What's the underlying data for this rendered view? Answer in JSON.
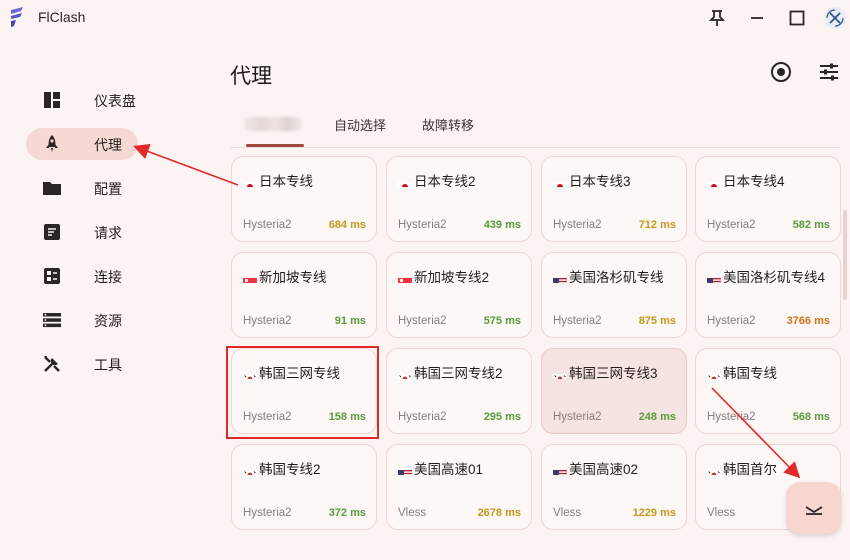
{
  "app": {
    "title": "FlClash"
  },
  "sidebar": {
    "items": [
      {
        "label": "仪表盘",
        "icon": "dashboard-icon",
        "active": false
      },
      {
        "label": "代理",
        "icon": "rocket-icon",
        "active": true
      },
      {
        "label": "配置",
        "icon": "folder-icon",
        "active": false
      },
      {
        "label": "请求",
        "icon": "request-icon",
        "active": false
      },
      {
        "label": "连接",
        "icon": "connection-icon",
        "active": false
      },
      {
        "label": "资源",
        "icon": "resources-icon",
        "active": false
      },
      {
        "label": "工具",
        "icon": "tools-icon",
        "active": false
      }
    ]
  },
  "header": {
    "title": "代理"
  },
  "tabs": [
    {
      "label": "",
      "redacted": true,
      "active": true
    },
    {
      "label": "自动选择",
      "active": false
    },
    {
      "label": "故障转移",
      "active": false
    }
  ],
  "proxies": [
    {
      "name": "日本专线",
      "flag": "jp",
      "type": "Hysteria2",
      "delay": "684 ms",
      "level": "mid"
    },
    {
      "name": "日本专线2",
      "flag": "jp",
      "type": "Hysteria2",
      "delay": "439 ms",
      "level": "good"
    },
    {
      "name": "日本专线3",
      "flag": "jp",
      "type": "Hysteria2",
      "delay": "712 ms",
      "level": "mid"
    },
    {
      "name": "日本专线4",
      "flag": "jp",
      "type": "Hysteria2",
      "delay": "582 ms",
      "level": "good"
    },
    {
      "name": "新加坡专线",
      "flag": "sg",
      "type": "Hysteria2",
      "delay": "91 ms",
      "level": "good"
    },
    {
      "name": "新加坡专线2",
      "flag": "sg",
      "type": "Hysteria2",
      "delay": "575 ms",
      "level": "good"
    },
    {
      "name": "美国洛杉矶专线",
      "flag": "us",
      "type": "Hysteria2",
      "delay": "875 ms",
      "level": "mid"
    },
    {
      "name": "美国洛杉矶专线4",
      "flag": "us",
      "type": "Hysteria2",
      "delay": "3766 ms",
      "level": "bad"
    },
    {
      "name": "韩国三网专线",
      "flag": "kr",
      "type": "Hysteria2",
      "delay": "158 ms",
      "level": "good"
    },
    {
      "name": "韩国三网专线2",
      "flag": "kr",
      "type": "Hysteria2",
      "delay": "295 ms",
      "level": "good"
    },
    {
      "name": "韩国三网专线3",
      "flag": "kr",
      "type": "Hysteria2",
      "delay": "248 ms",
      "level": "good",
      "selected": true
    },
    {
      "name": "韩国专线",
      "flag": "kr",
      "type": "Hysteria2",
      "delay": "568 ms",
      "level": "good"
    },
    {
      "name": "韩国专线2",
      "flag": "kr",
      "type": "Hysteria2",
      "delay": "372 ms",
      "level": "good"
    },
    {
      "name": "美国高速01",
      "flag": "us",
      "type": "Vless",
      "delay": "2678 ms",
      "level": "mid"
    },
    {
      "name": "美国高速02",
      "flag": "us",
      "type": "Vless",
      "delay": "1229 ms",
      "level": "mid"
    },
    {
      "name": "韩国首尔",
      "flag": "kr",
      "type": "Vless",
      "delay": "",
      "level": "mid"
    }
  ],
  "colors": {
    "accent": "#9b4a3c",
    "good": "#5a9b3a",
    "mid": "#c29a1d",
    "bad": "#d0751c",
    "annotation": "#e02a2a"
  }
}
